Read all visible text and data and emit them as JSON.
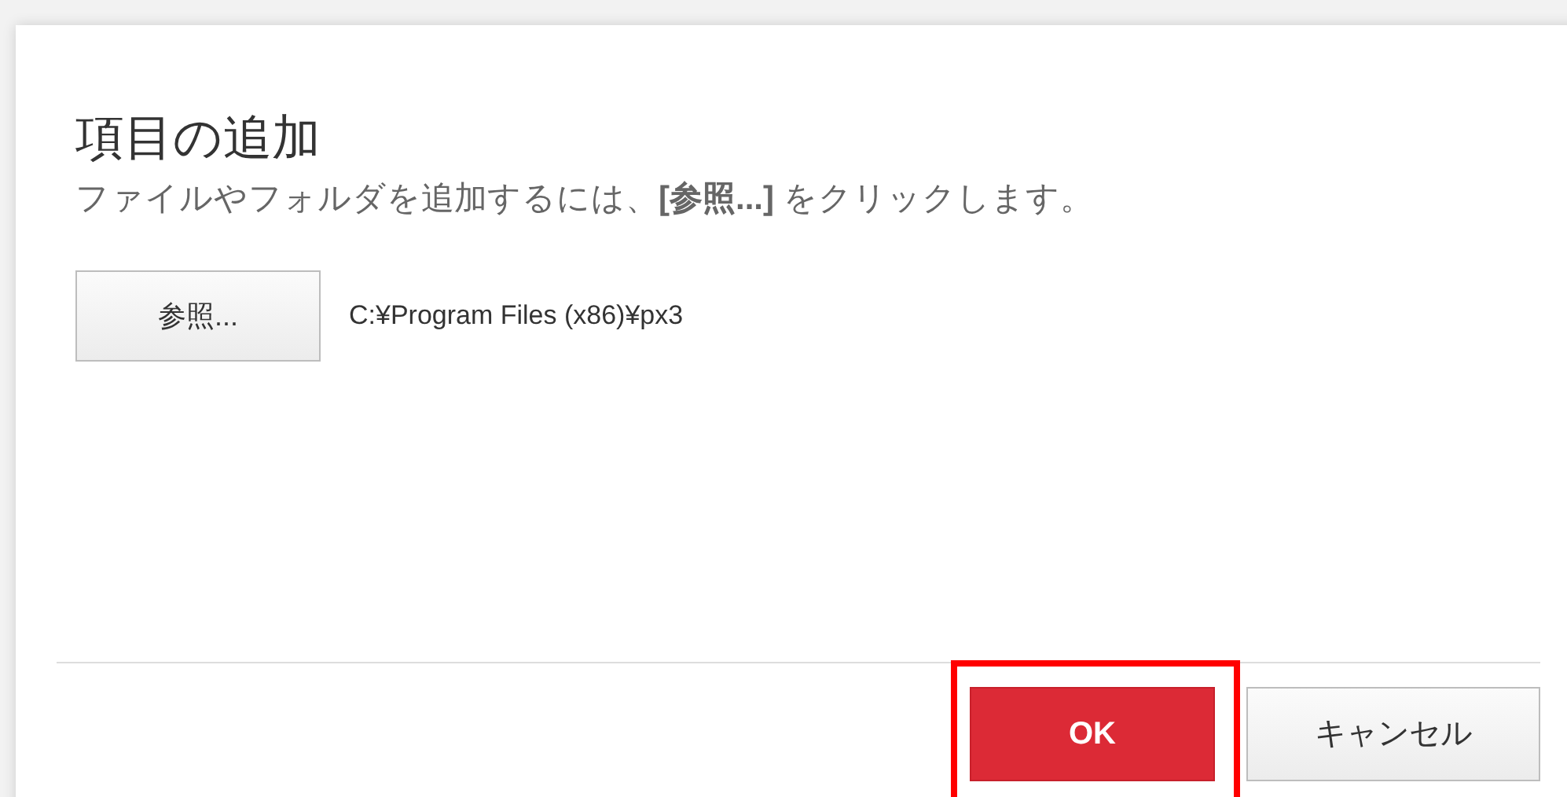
{
  "dialog": {
    "title": "項目の追加",
    "description": "ファイルやフォルダを追加するには、**[参照...]** をクリックします。"
  },
  "browse": {
    "label": "参照...",
    "path": "C:¥Program Files (x86)¥px3"
  },
  "buttons": [
    {
      "label": "OK",
      "kind": "primary",
      "highlighted": true
    },
    {
      "label": "キャンセル",
      "kind": "default",
      "highlighted": false
    }
  ]
}
